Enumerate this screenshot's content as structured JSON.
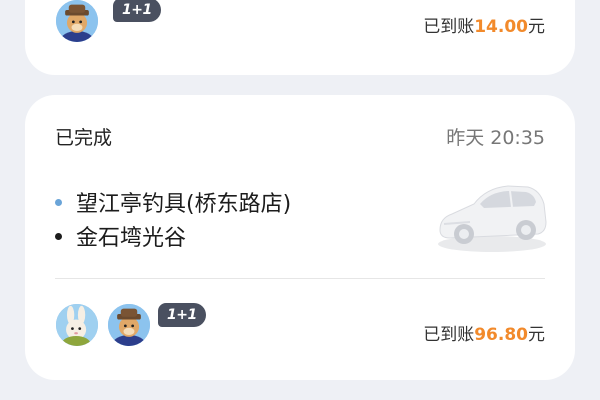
{
  "top_card": {
    "badge": "1+1",
    "amount_prefix": "已到账",
    "amount_value": "14.00",
    "amount_suffix": "元"
  },
  "order": {
    "status": "已完成",
    "time": "昨天 20:35",
    "route": {
      "start": "望江亭钓具(桥东路店)",
      "end": "金石塆光谷"
    },
    "badge": "1+1",
    "amount_prefix": "已到账",
    "amount_value": "96.80",
    "amount_suffix": "元"
  },
  "colors": {
    "accent_amount": "#f28a2b",
    "start_dot": "#6aa4d8",
    "badge_bg": "#4a5060"
  },
  "icons": {
    "avatars": [
      "dog-avatar-icon",
      "rabbit-avatar-icon"
    ],
    "vehicle": "car-icon"
  }
}
